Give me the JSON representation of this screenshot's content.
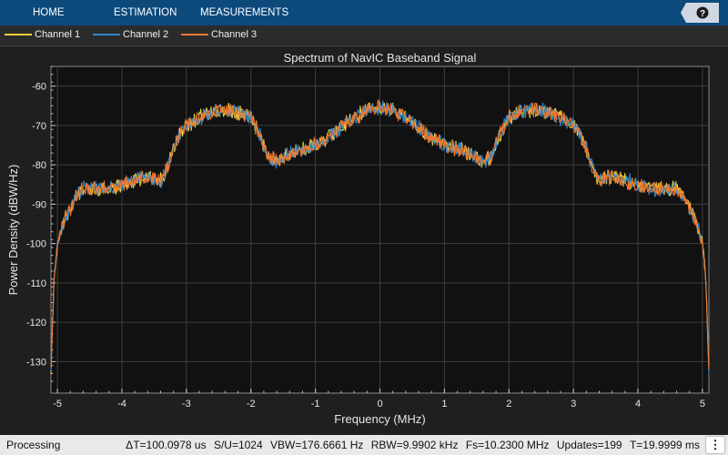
{
  "toolstrip": {
    "tabs": [
      "HOME",
      "ESTIMATION",
      "MEASUREMENTS"
    ],
    "help_label": "?"
  },
  "legend": {
    "channels": [
      {
        "name": "Channel 1",
        "color": "#edd03a"
      },
      {
        "name": "Channel 2",
        "color": "#2f86c9"
      },
      {
        "name": "Channel 3",
        "color": "#ee7830"
      }
    ]
  },
  "chart_data": {
    "type": "line",
    "title": "Spectrum of NavIC Baseband Signal",
    "xlabel": "Frequency (MHz)",
    "ylabel": "Power Density (dBW/Hz)",
    "xlim": [
      -5.1,
      5.1
    ],
    "ylim": [
      -138,
      -55
    ],
    "xticks": [
      -5,
      -4,
      -3,
      -2,
      -1,
      0,
      1,
      2,
      3,
      4,
      5
    ],
    "yticks": [
      -60,
      -70,
      -80,
      -90,
      -100,
      -110,
      -120,
      -130
    ],
    "grid": true,
    "background": "#111111",
    "series": [
      {
        "name": "Channel 1",
        "color": "#edd03a"
      },
      {
        "name": "Channel 2",
        "color": "#2f86c9"
      },
      {
        "name": "Channel 3",
        "color": "#ee7830"
      }
    ],
    "envelope": {
      "x": [
        -5.1,
        -5.05,
        -5.0,
        -4.9,
        -4.8,
        -4.7,
        -4.6,
        -4.4,
        -4.2,
        -4.0,
        -3.8,
        -3.6,
        -3.4,
        -3.3,
        -3.2,
        -3.1,
        -3.0,
        -2.8,
        -2.6,
        -2.4,
        -2.2,
        -2.0,
        -1.9,
        -1.8,
        -1.7,
        -1.6,
        -1.5,
        -1.3,
        -1.1,
        -0.9,
        -0.7,
        -0.5,
        -0.3,
        -0.15,
        0.0,
        0.15,
        0.3,
        0.5,
        0.7,
        0.9,
        1.1,
        1.3,
        1.5,
        1.6,
        1.7,
        1.8,
        1.9,
        2.0,
        2.2,
        2.4,
        2.6,
        2.8,
        3.0,
        3.1,
        3.2,
        3.3,
        3.4,
        3.6,
        3.8,
        4.0,
        4.2,
        4.4,
        4.6,
        4.7,
        4.8,
        4.9,
        5.0,
        5.05,
        5.1
      ],
      "y": [
        -132,
        -108,
        -100,
        -94,
        -91,
        -88,
        -86,
        -86,
        -86,
        -85,
        -84,
        -83,
        -84,
        -81,
        -76,
        -72,
        -70,
        -68,
        -66.5,
        -66,
        -66.5,
        -68,
        -71,
        -75,
        -78.5,
        -79,
        -78,
        -76.5,
        -75.5,
        -74,
        -72,
        -69,
        -67,
        -65.8,
        -65.5,
        -65.8,
        -67,
        -69,
        -72,
        -74,
        -75.5,
        -76.5,
        -78,
        -79,
        -78.5,
        -75,
        -71,
        -68,
        -66.5,
        -66,
        -66.5,
        -68,
        -70,
        -72,
        -76,
        -81,
        -84,
        -83,
        -84,
        -85,
        -86,
        -86,
        -86,
        -88,
        -91,
        -94,
        -100,
        -108,
        -132
      ]
    }
  },
  "status": {
    "left": "Processing",
    "items": [
      "ΔT=100.0978 us",
      "S/U=1024",
      "VBW=176.6661 Hz",
      "RBW=9.9902 kHz",
      "Fs=10.2300 MHz",
      "Updates=199",
      "T=19.9999 ms"
    ],
    "more_label": "⋮"
  }
}
